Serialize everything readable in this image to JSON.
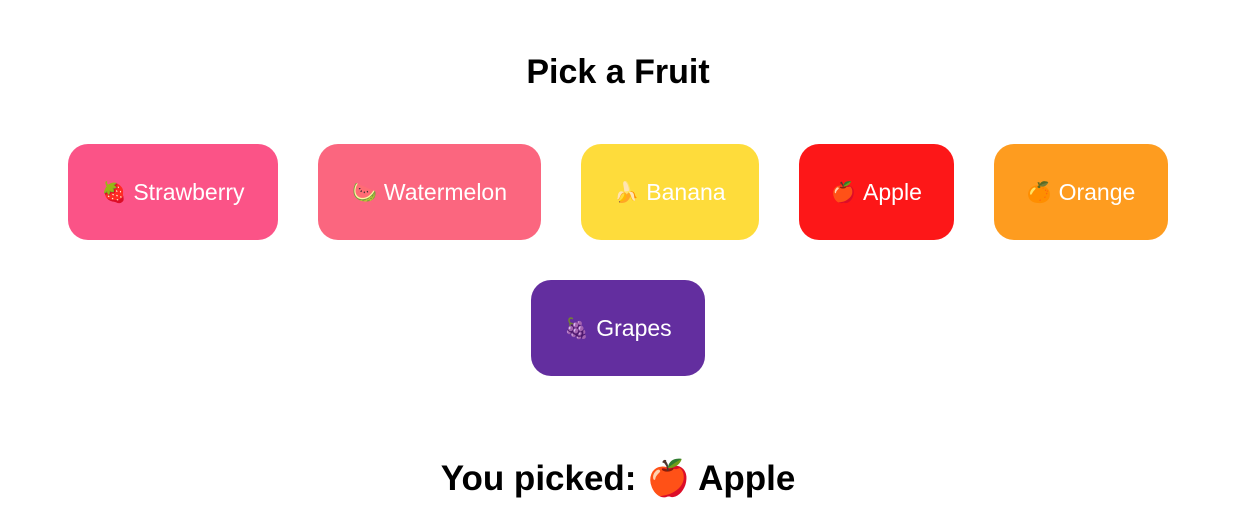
{
  "title": "Pick a Fruit",
  "fruits": [
    {
      "emoji": "🍓",
      "label": "Strawberry",
      "color": "#fb5387"
    },
    {
      "emoji": "🍉",
      "label": "Watermelon",
      "color": "#fb667f"
    },
    {
      "emoji": "🍌",
      "label": "Banana",
      "color": "#fedc3b"
    },
    {
      "emoji": "🍎",
      "label": "Apple",
      "color": "#fd1718"
    },
    {
      "emoji": "🍊",
      "label": "Orange",
      "color": "#fe9c1f"
    },
    {
      "emoji": "🍇",
      "label": "Grapes",
      "color": "#632e9f"
    }
  ],
  "result": {
    "prefix": "You picked:",
    "emoji": "🍎",
    "label": "Apple"
  }
}
